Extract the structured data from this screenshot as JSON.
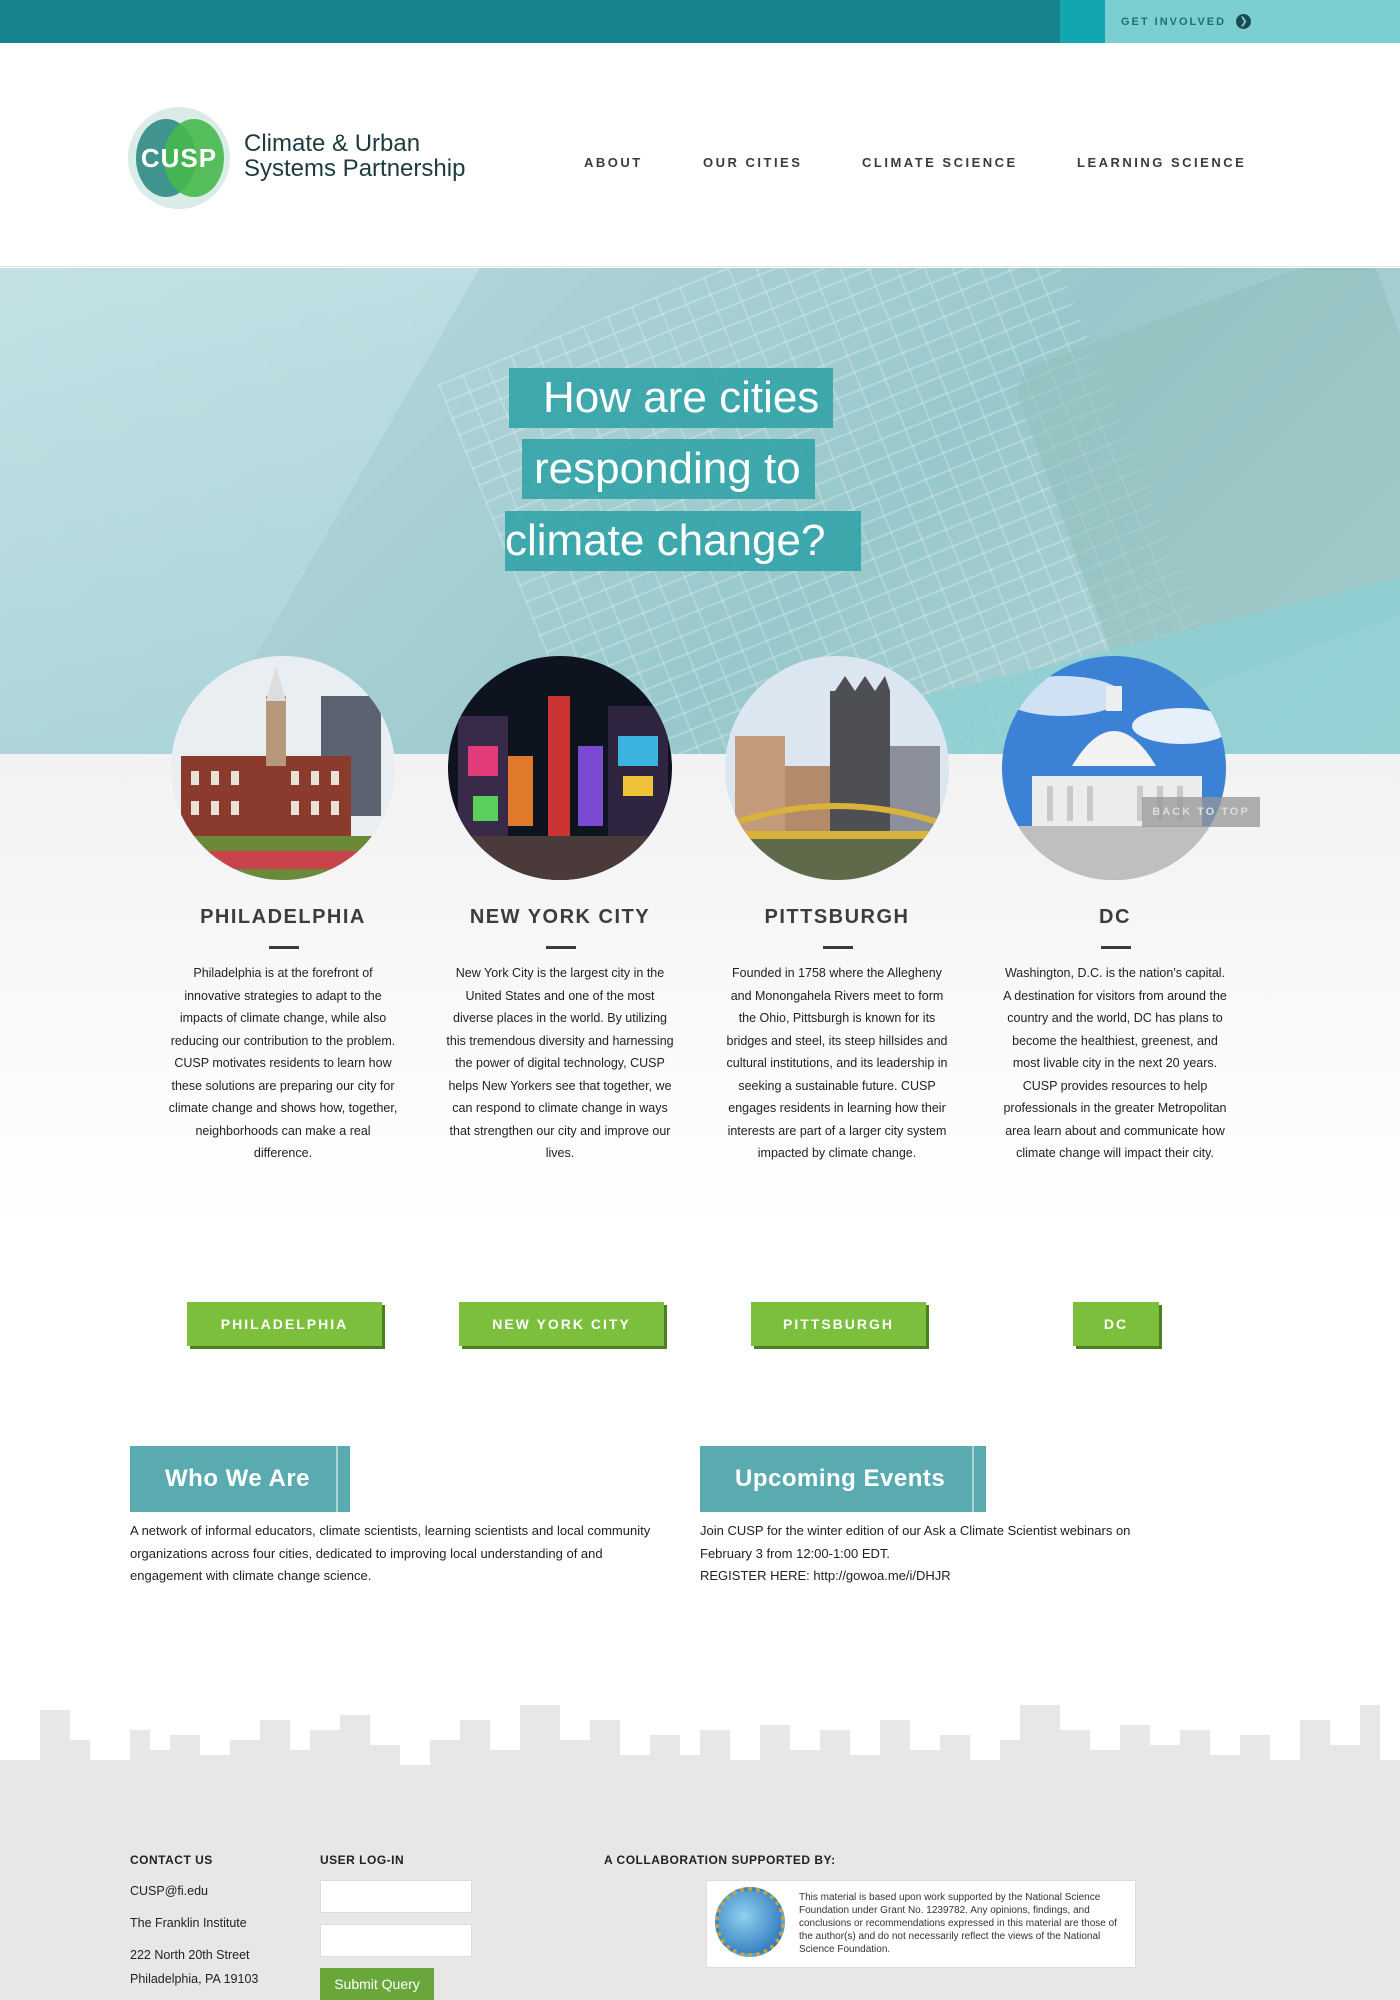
{
  "topbar": {
    "get_involved": "GET INVOLVED",
    "arrow_icon": "chevron-right-icon"
  },
  "header": {
    "logo_text": "CUSP",
    "logo_name_line1": "Climate & Urban",
    "logo_name_line2": "Systems Partnership",
    "nav": [
      "ABOUT",
      "OUR CITIES",
      "CLIMATE SCIENCE",
      "LEARNING SCIENCE"
    ]
  },
  "hero": {
    "line1": "How are cities",
    "line2": "responding to",
    "line3": "climate change?"
  },
  "cities": [
    {
      "title": "PHILADELPHIA",
      "desc": "Philadelphia is at the forefront of innovative strategies to adapt to the impacts of climate change, while also reducing our contribution to the problem.  CUSP motivates residents to learn how these solutions are preparing our city for climate change and shows how, together, neighborhoods can make a real difference.",
      "button": "PHILADELPHIA"
    },
    {
      "title": "NEW YORK CITY",
      "desc": "New York City is the largest city in the United States and one of the most diverse places in the world. By utilizing this tremendous diversity and harnessing the power of digital technology, CUSP helps New Yorkers see that together, we can respond to climate change in ways that strengthen our city and improve our lives.",
      "button": "NEW YORK CITY"
    },
    {
      "title": "PITTSBURGH",
      "desc": "Founded in 1758 where the Allegheny and Monongahela Rivers meet to form the Ohio, Pittsburgh is known for its bridges and steel, its steep hillsides and cultural institutions, and its leadership in seeking a sustainable future. CUSP engages residents in learning how their interests are part of a larger city system impacted by climate change.",
      "button": "PITTSBURGH"
    },
    {
      "title": "DC",
      "desc": "Washington, D.C. is the nation's capital. A destination for visitors from around the country and the world, DC has plans to become the healthiest, greenest, and most livable city in the next 20 years. CUSP provides resources to help professionals in the greater Metropolitan area learn about and communicate how climate change will impact their city.",
      "button": "DC"
    }
  ],
  "back_to_top": "BACK TO TOP",
  "who": {
    "title": "Who We Are",
    "text": "A network of informal educators, climate scientists, learning scientists and local community organizations across four cities, dedicated to improving local understanding of and engagement with climate change science."
  },
  "events": {
    "title": "Upcoming Events",
    "line1": "Join CUSP for the winter edition of our Ask a Climate Scientist webinars on",
    "line2": "February 3 from 12:00-1:00 EDT.",
    "line3": "REGISTER HERE: http://gowoa.me/i/DHJR"
  },
  "footer": {
    "contact_heading": "CONTACT US",
    "email": "CUSP@fi.edu",
    "org": "The Franklin Institute",
    "address1": "222 North 20th Street",
    "address2": "Philadelphia, PA 19103",
    "login_heading": "USER LOG-IN",
    "submit": "Submit Query",
    "collab_heading": "A COLLABORATION SUPPORTED BY:",
    "nsf_text": "This material is based upon work supported by the National Science Foundation under Grant No. 1239782. Any opinions, findings, and conclusions or recommendations expressed in this material are those of the author(s) and do not necessarily reflect the views of the National Science Foundation."
  }
}
